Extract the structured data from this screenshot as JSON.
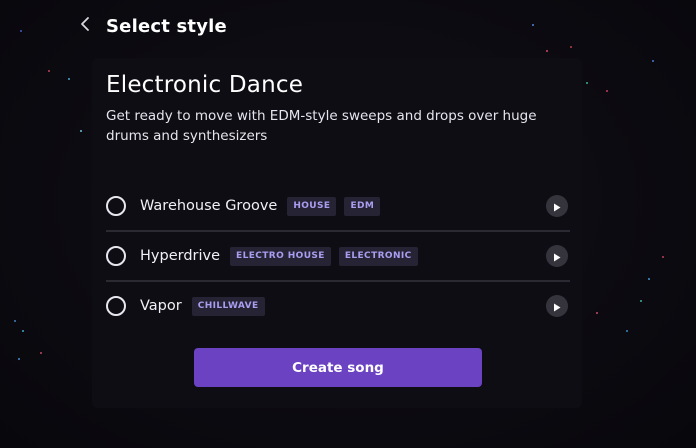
{
  "header": {
    "back_icon": "chevron-left-icon",
    "title": "Select style"
  },
  "genre": {
    "title": "Electronic Dance",
    "description": "Get ready to move with EDM-style sweeps and drops over huge drums and synthesizers"
  },
  "styles": [
    {
      "name": "Warehouse Groove",
      "tags": [
        "HOUSE",
        "EDM"
      ],
      "selected": false,
      "play_icon": "play-icon"
    },
    {
      "name": "Hyperdrive",
      "tags": [
        "ELECTRO HOUSE",
        "ELECTRONIC"
      ],
      "selected": false,
      "play_icon": "play-icon"
    },
    {
      "name": "Vapor",
      "tags": [
        "CHILLWAVE"
      ],
      "selected": false,
      "play_icon": "play-icon"
    }
  ],
  "actions": {
    "create_label": "Create song"
  },
  "colors": {
    "background": "#0b0a10",
    "accent": "#6a42c2",
    "tag_background": "#262434",
    "tag_text": "#a99df0",
    "divider": "#2b2a33",
    "play_button": "#35343c"
  }
}
